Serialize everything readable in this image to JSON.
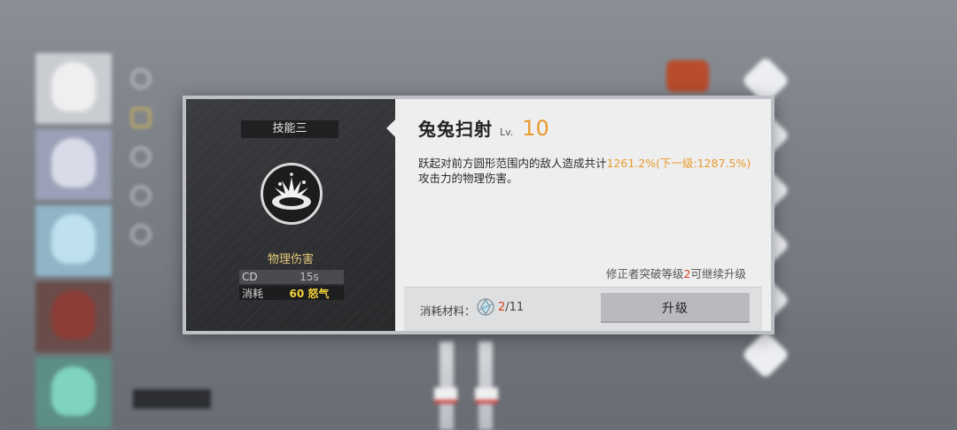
{
  "dialog": {
    "skill_slot": "技能三",
    "skill_icon": "shockwave-crater-icon",
    "damage_type": "物理伤害",
    "stats": {
      "cd_label": "CD",
      "cd_value": "15s",
      "cost_label": "消耗",
      "cost_value": "60 怒气"
    },
    "skill_name": "兔兔扫射",
    "level_label": "Lv.",
    "level_value": "10",
    "description_prefix": "跃起对前方圆形范围内的敌人造成共计",
    "description_highlight": "1261.2%(下一级:1287.5%)",
    "description_suffix": "攻击力的物理伤害。",
    "requirement_prefix": "修正者突破等级",
    "requirement_level": "2",
    "requirement_suffix": "可继续升级",
    "materials": {
      "label": "消耗材料：",
      "icon": "crystal-core-icon",
      "have": "2",
      "need": "/11"
    },
    "upgrade_label": "升级"
  },
  "colors": {
    "accent_orange": "#e99a2c",
    "warning_red": "#d9411e",
    "rage_yellow": "#f3d23a",
    "damage_gold": "#e2c97a"
  }
}
